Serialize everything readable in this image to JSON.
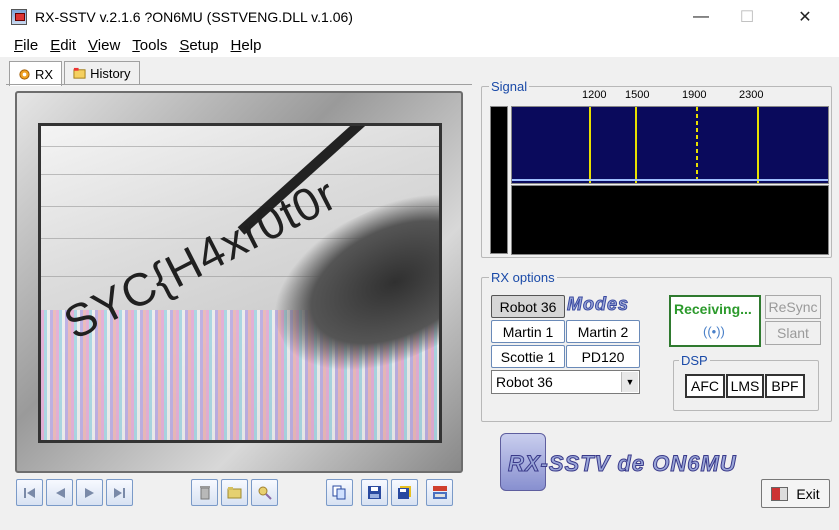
{
  "window": {
    "title": "RX-SSTV v.2.1.6 ?ON6MU (SSTVENG.DLL v.1.06)",
    "minimize_glyph": "—",
    "maximize_glyph": "☐",
    "close_glyph": "✕"
  },
  "menu": [
    {
      "accel": "F",
      "rest": "ile"
    },
    {
      "accel": "E",
      "rest": "dit"
    },
    {
      "accel": "V",
      "rest": "iew"
    },
    {
      "accel": "T",
      "rest": "ools"
    },
    {
      "accel": "S",
      "rest": "etup"
    },
    {
      "accel": "H",
      "rest": "elp"
    }
  ],
  "tabs": {
    "rx": "RX",
    "history": "History"
  },
  "image": {
    "captured_text": "SYC{H4xr0t0r"
  },
  "signal": {
    "label": "Signal",
    "freqs": [
      "1200",
      "1500",
      "1900",
      "2300"
    ]
  },
  "rx_options": {
    "label": "RX options",
    "modes_logo": "Modes",
    "modes": [
      "Robot 36",
      "Martin 1",
      "Martin 2",
      "Scottie 1",
      "PD120"
    ],
    "selected_mode": "Robot 36",
    "dropdown_value": "Robot 36",
    "status": "Receiving...",
    "resync": "ReSync",
    "slant": "Slant"
  },
  "dsp": {
    "label": "DSP",
    "afc": "AFC",
    "lms": "LMS",
    "bpf": "BPF"
  },
  "brand": "RX-SSTV de ON6MU",
  "exit": "Exit",
  "colors": {
    "spectrum_bg": "#0a0a5c",
    "marker": "#e8e000",
    "receiving": "#2c9a2c",
    "group_label": "#1a4aa8"
  }
}
